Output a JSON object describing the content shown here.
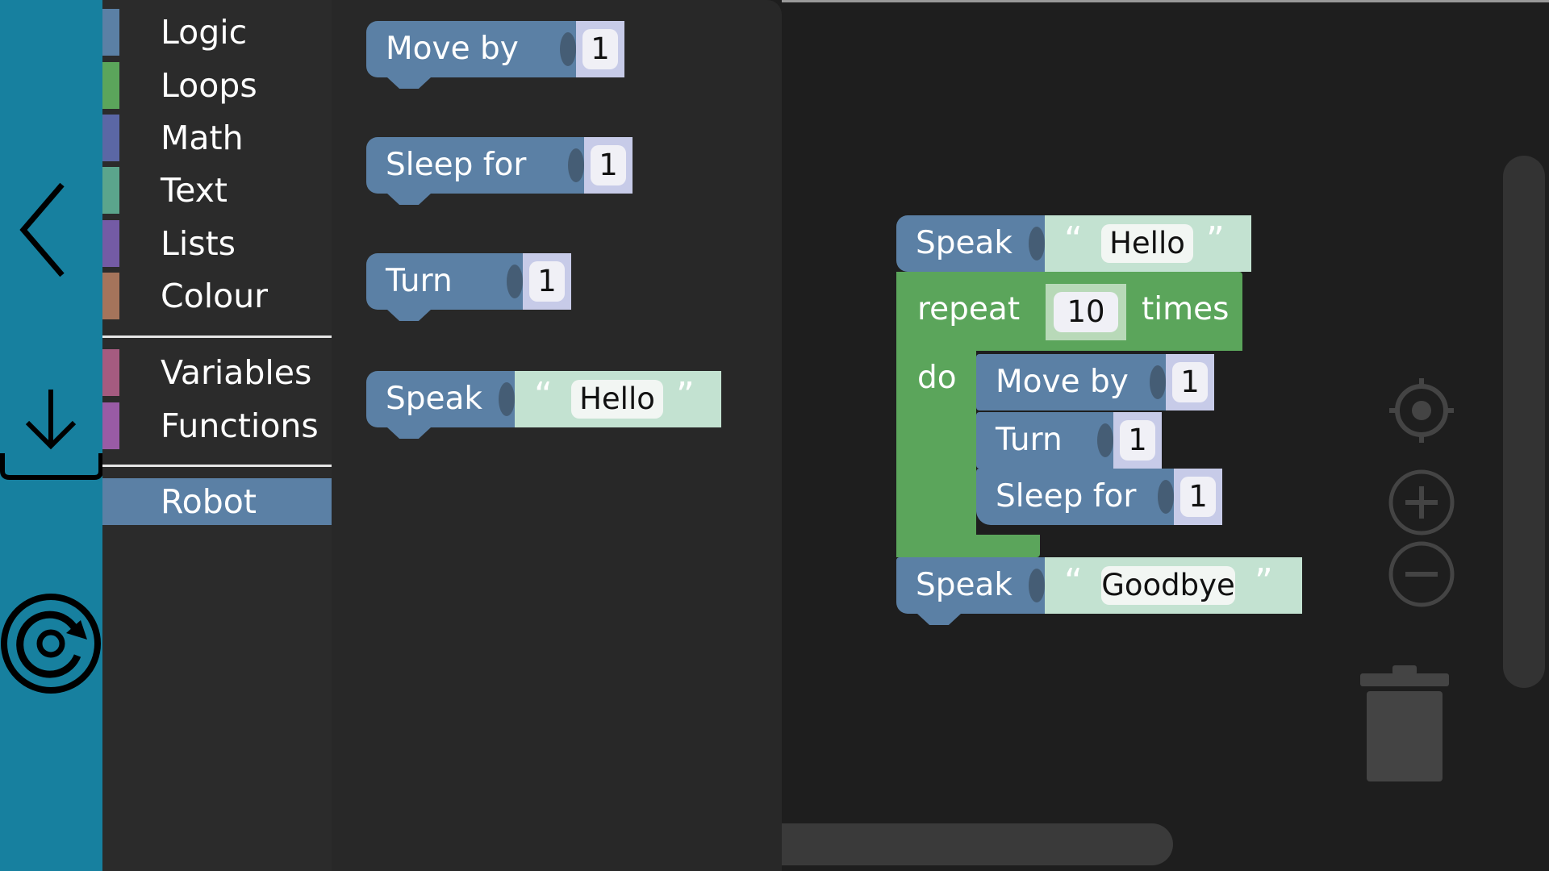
{
  "categories": [
    {
      "label": "Logic",
      "color": "#5b80a5"
    },
    {
      "label": "Loops",
      "color": "#5ba55b"
    },
    {
      "label": "Math",
      "color": "#5b67a5"
    },
    {
      "label": "Text",
      "color": "#5ba58c"
    },
    {
      "label": "Lists",
      "color": "#745ba5"
    },
    {
      "label": "Colour",
      "color": "#a5745b"
    },
    {
      "label": "Variables",
      "color": "#a55b80"
    },
    {
      "label": "Functions",
      "color": "#995ba5"
    },
    {
      "label": "Robot",
      "color": "#5b80a5",
      "selected": true
    }
  ],
  "flyout": {
    "move_by": {
      "label": "Move by",
      "value": "1"
    },
    "sleep_for": {
      "label": "Sleep for",
      "value": "1"
    },
    "turn": {
      "label": "Turn",
      "value": "1"
    },
    "speak": {
      "label": "Speak",
      "value": "Hello"
    }
  },
  "workspace": {
    "speak_start": {
      "label": "Speak",
      "value": "Hello"
    },
    "repeat": {
      "label": "repeat",
      "count": "10",
      "times_label": "times",
      "do_label": "do"
    },
    "move_by": {
      "label": "Move by",
      "value": "1"
    },
    "turn": {
      "label": "Turn",
      "value": "1"
    },
    "sleep_for": {
      "label": "Sleep for",
      "value": "1"
    },
    "speak_end": {
      "label": "Speak",
      "value": "Goodbye"
    }
  },
  "glyphs": {
    "open_quote": "“",
    "close_quote": "”"
  },
  "icons": [
    "back-chevron-icon",
    "download-icon",
    "reset-icon",
    "recenter-icon",
    "zoom-in-icon",
    "zoom-out-icon",
    "trash-icon"
  ]
}
